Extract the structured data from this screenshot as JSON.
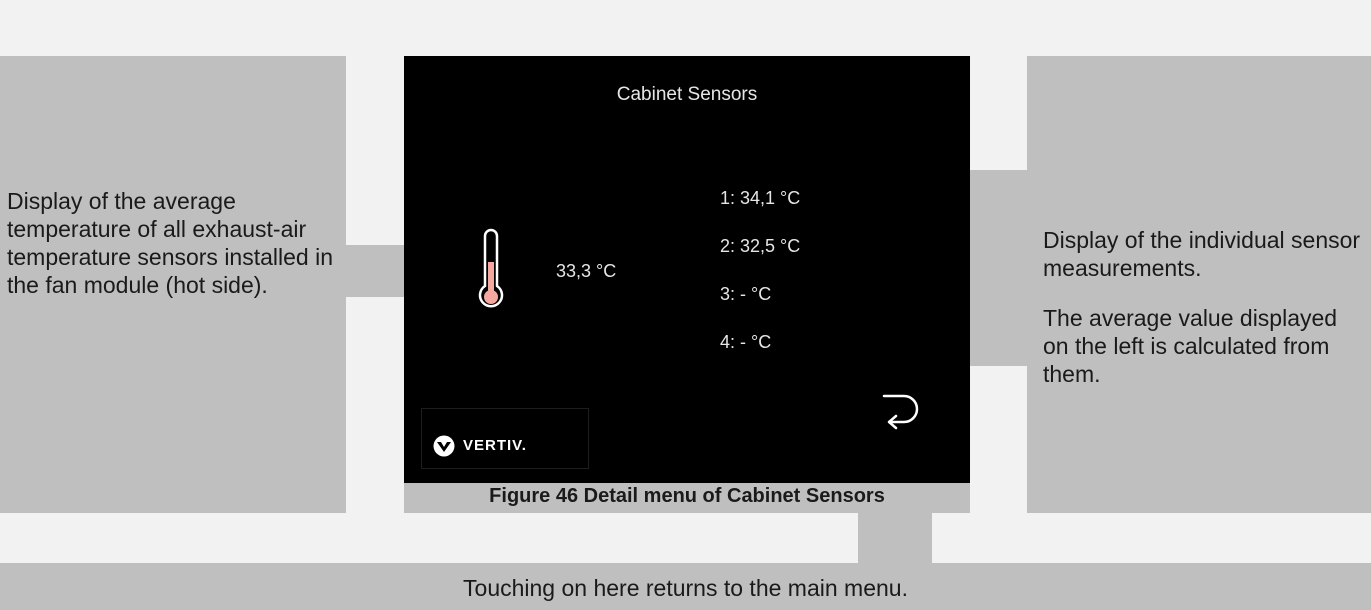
{
  "annotations": {
    "left": "Display of the average temperature of all exhaust-air temperature sensors installed in the fan module (hot side).",
    "right_1": "Display of the individual sensor measurements.",
    "right_2": "The average value displayed on the left is calculated from them.",
    "bottom": "Touching on here returns to the main menu."
  },
  "screen": {
    "title": "Cabinet Sensors",
    "average": "33,3 °C",
    "sensors": [
      "1: 34,1 °C",
      "2: 32,5 °C",
      "3: - °C",
      "4: - °C"
    ],
    "back_icon": "return-arrow-icon",
    "brand": "VERTIV."
  },
  "caption": "Figure 46 Detail menu of Cabinet Sensors",
  "colors": {
    "panel_grey": "#bfbfbf",
    "screen_bg": "#000000",
    "thermo_fill": "#f4a8a0"
  }
}
